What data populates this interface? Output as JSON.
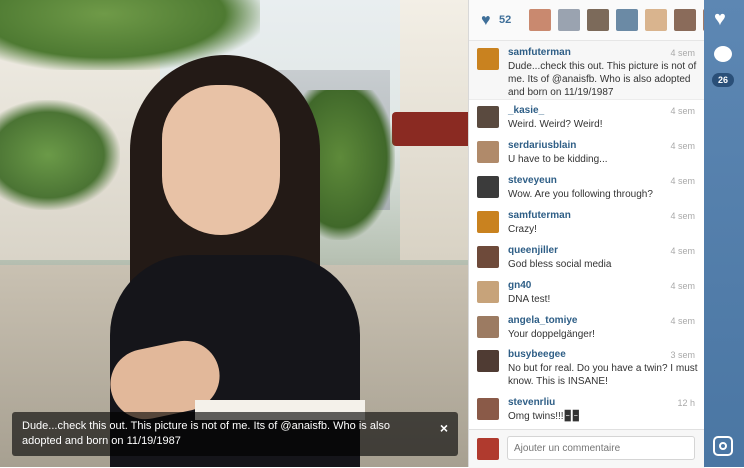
{
  "photo": {
    "caption": "Dude...check this out. This picture is not of me. Its of @anaisfb. Who is also adopted and born on 11/19/1987",
    "close_glyph": "×"
  },
  "likes": {
    "count": "52",
    "icon": "heart-icon",
    "avatar_colors": [
      "#c9896f",
      "#9aa3b0",
      "#7c6a5a",
      "#6b8aa5",
      "#d9b48e",
      "#8a6b5a",
      "#a07a68"
    ]
  },
  "comments": [
    {
      "user": "samfuterman",
      "time": "4 sem",
      "text": "Dude...check this out. This picture is not of me. Its of @anaisfb. Who is also adopted and born on 11/19/1987",
      "avatar_color": "#c9821f"
    },
    {
      "user": "_kasie_",
      "time": "4 sem",
      "text": "Weird. Weird? Weird!",
      "avatar_color": "#5a4a3f"
    },
    {
      "user": "serdariusblain",
      "time": "4 sem",
      "text": "U have to be kidding...",
      "avatar_color": "#b08a6a"
    },
    {
      "user": "steveyeun",
      "time": "4 sem",
      "text": "Wow. Are you following through?",
      "avatar_color": "#3b3b3b"
    },
    {
      "user": "samfuterman",
      "time": "4 sem",
      "text": "Crazy!",
      "avatar_color": "#c9821f"
    },
    {
      "user": "queenjiller",
      "time": "4 sem",
      "text": "God bless social media",
      "avatar_color": "#6e4a3a"
    },
    {
      "user": "gn40",
      "time": "4 sem",
      "text": "DNA test!",
      "avatar_color": "#c7a37a"
    },
    {
      "user": "angela_tomiye",
      "time": "4 sem",
      "text": "Your doppelgänger!",
      "avatar_color": "#9c7b62"
    },
    {
      "user": "busybeegee",
      "time": "3 sem",
      "text": "No but for real. Do you have a twin? I must know. This is INSANE!",
      "avatar_color": "#4f3b33"
    },
    {
      "user": "stevenrliu",
      "time": "12 h",
      "text": "Omg twins!!!🁢🁢",
      "avatar_color": "#8a5a48"
    }
  ],
  "comment_input": {
    "placeholder": "Ajouter un commentaire"
  },
  "rail": {
    "heart_icon": "heart-icon",
    "comment_icon": "comment-bubble-icon",
    "comment_count": "26",
    "camera_icon": "instagram-camera-icon"
  }
}
